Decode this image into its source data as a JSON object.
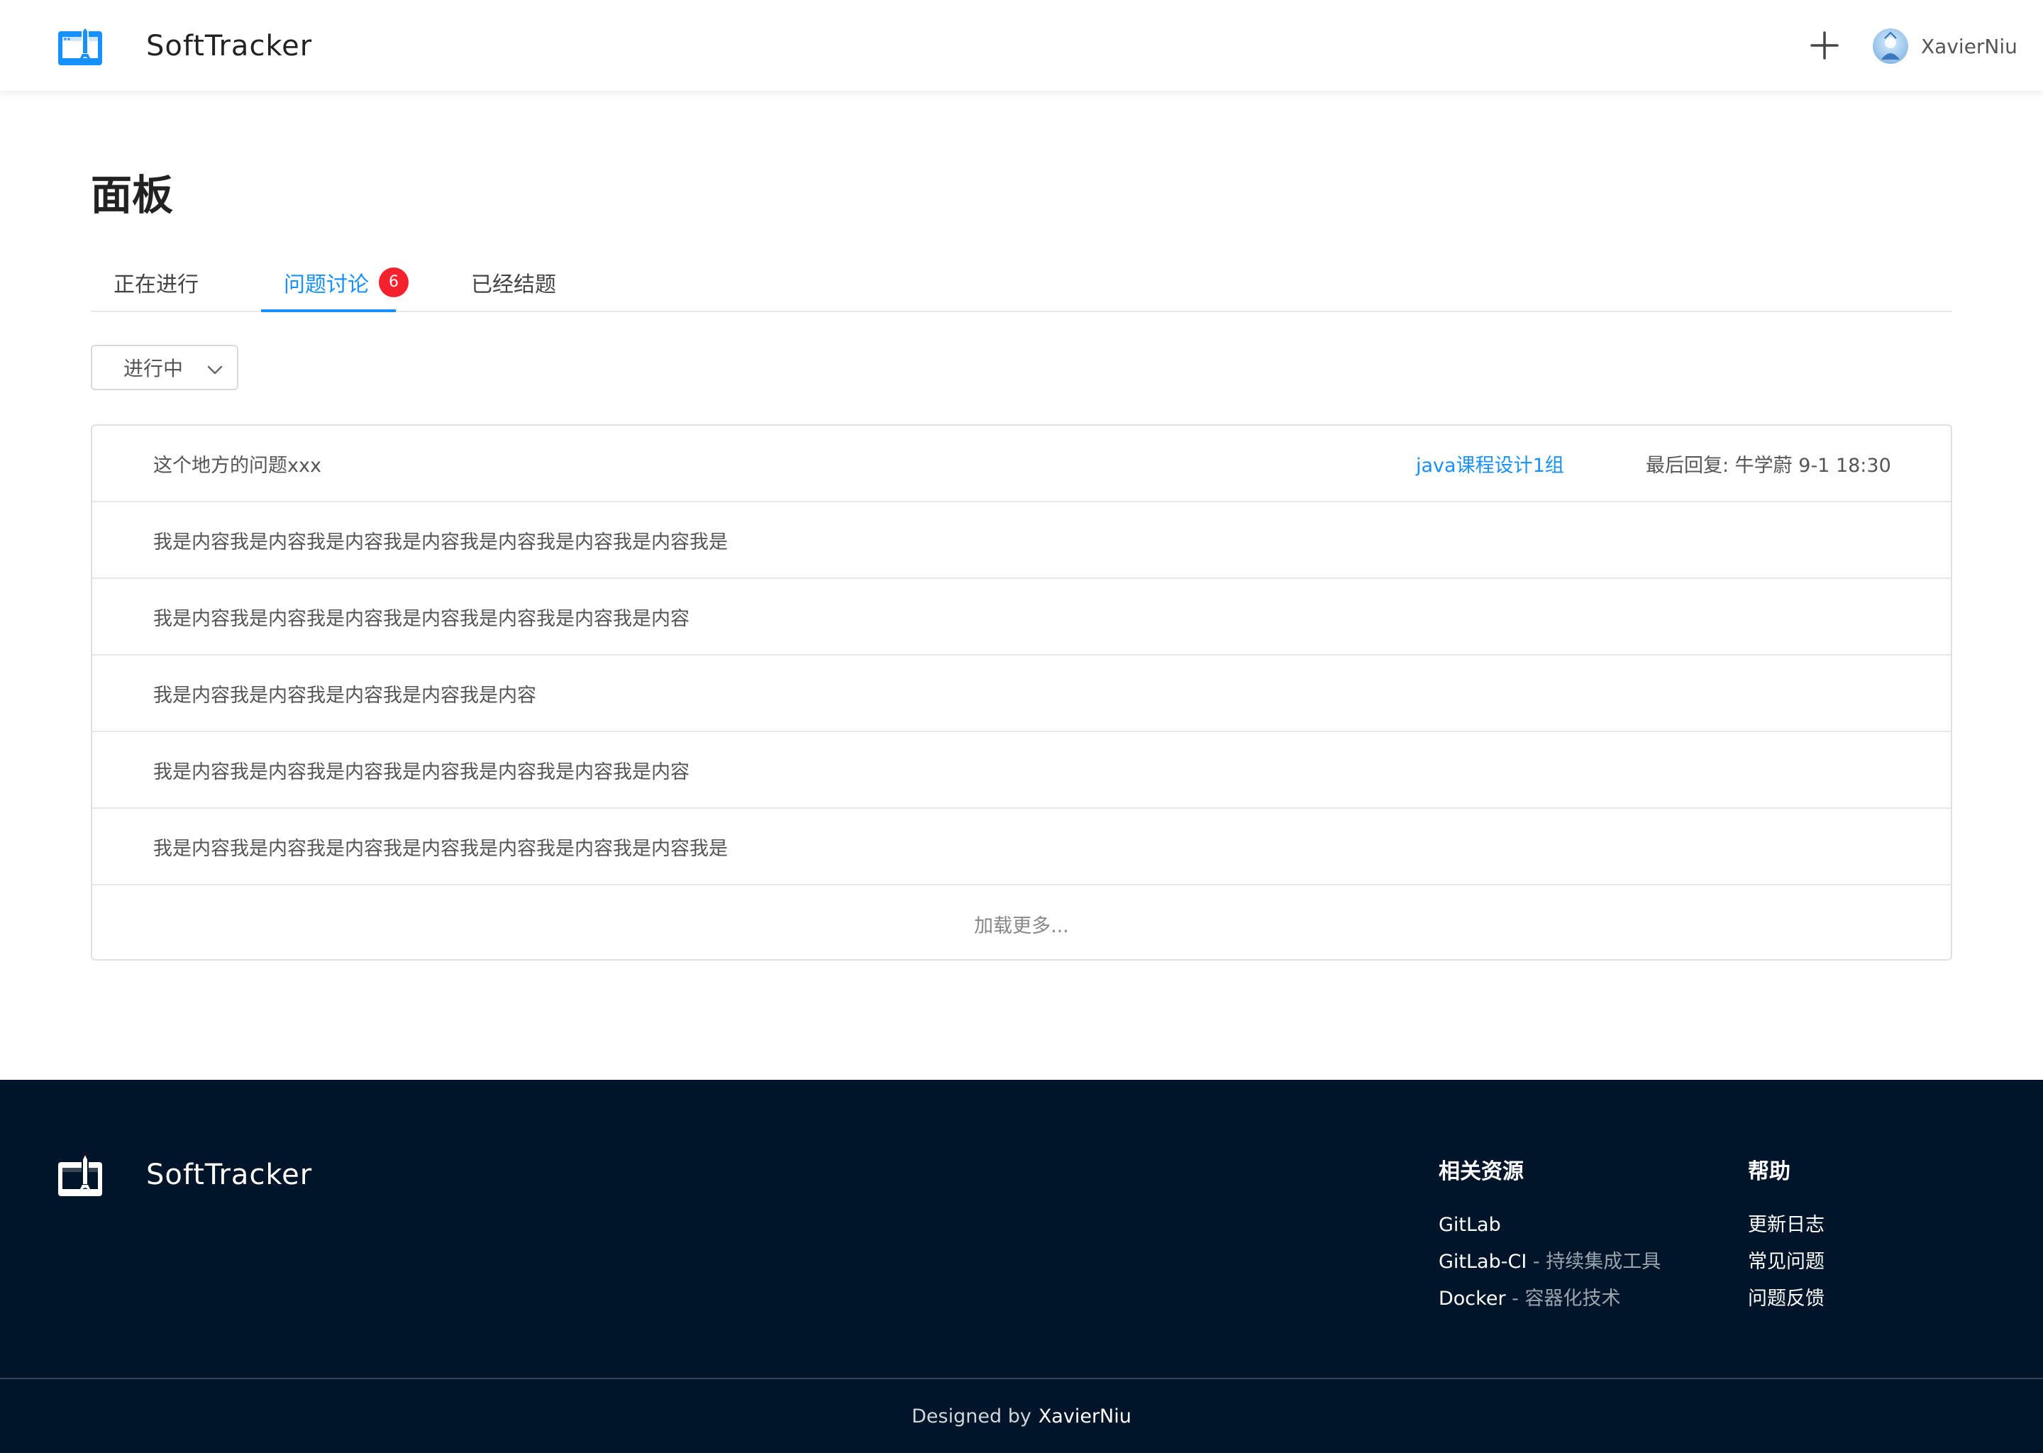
{
  "header": {
    "brand_name": "SoftTracker",
    "plus_icon": "plus-icon",
    "user_name": "XavierNiu"
  },
  "main": {
    "title": "面板",
    "tabs": [
      {
        "label": "正在进行",
        "active": false
      },
      {
        "label": "问题讨论",
        "active": true,
        "badge": "6"
      },
      {
        "label": "已经结题",
        "active": false
      }
    ],
    "status_filter": {
      "value": "进行中"
    },
    "list": {
      "first_row": {
        "text": "这个地方的问题xxx",
        "group": "java课程设计1组",
        "reply": "最后回复: 牛学蔚 9-1 18:30"
      },
      "rows": [
        "我是内容我是内容我是内容我是内容我是内容我是内容我是内容我是",
        "我是内容我是内容我是内容我是内容我是内容我是内容我是内容",
        "我是内容我是内容我是内容我是内容我是内容",
        "我是内容我是内容我是内容我是内容我是内容我是内容我是内容",
        "我是内容我是内容我是内容我是内容我是内容我是内容我是内容我是"
      ],
      "load_more": "加载更多..."
    }
  },
  "footer": {
    "brand_name": "SoftTracker",
    "resources": {
      "title": "相关资源",
      "links": [
        {
          "name": "GitLab",
          "desc": ""
        },
        {
          "name": "GitLab-CI",
          "desc": " - 持续集成工具"
        },
        {
          "name": "Docker",
          "desc": " - 容器化技术"
        }
      ]
    },
    "help": {
      "title": "帮助",
      "links": [
        "更新日志",
        "常见问题",
        "问题反馈"
      ]
    },
    "credit_prefix": "Designed by",
    "credit_name": "XavierNiu"
  },
  "colors": {
    "accent": "#1890ff",
    "badge": "#f5222d",
    "footer_bg": "#001529"
  }
}
